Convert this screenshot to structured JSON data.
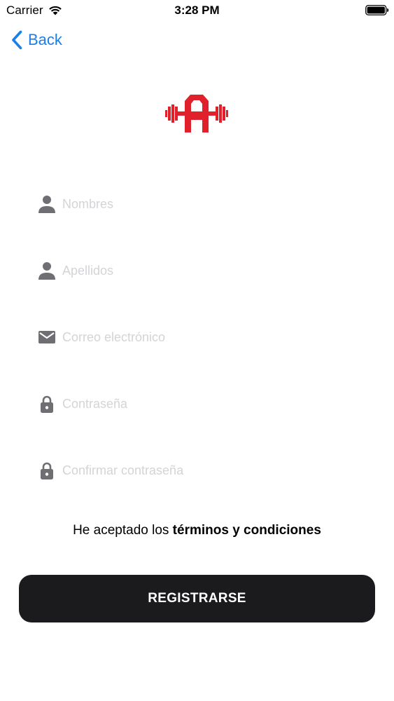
{
  "status_bar": {
    "carrier": "Carrier",
    "time": "3:28 PM"
  },
  "nav": {
    "back_label": "Back"
  },
  "form": {
    "fields": [
      {
        "name": "first-names",
        "icon": "person-icon",
        "placeholder": "Nombres",
        "value": ""
      },
      {
        "name": "last-names",
        "icon": "person-icon",
        "placeholder": "Apellidos",
        "value": ""
      },
      {
        "name": "email",
        "icon": "mail-icon",
        "placeholder": "Correo electrónico",
        "value": ""
      },
      {
        "name": "password",
        "icon": "lock-icon",
        "placeholder": "Contraseña",
        "value": ""
      },
      {
        "name": "confirm-password",
        "icon": "lock-icon",
        "placeholder": "Confirmar contraseña",
        "value": ""
      }
    ]
  },
  "terms": {
    "prefix": "He aceptado los ",
    "link": "términos y condiciones"
  },
  "register": {
    "label": "REGISTRARSE"
  },
  "colors": {
    "accent": "#1a7fe8",
    "logo_red": "#e0202a",
    "button_bg": "#1b1a1d",
    "icon_gray": "#6f6f73",
    "placeholder": "#d4d4d8"
  }
}
